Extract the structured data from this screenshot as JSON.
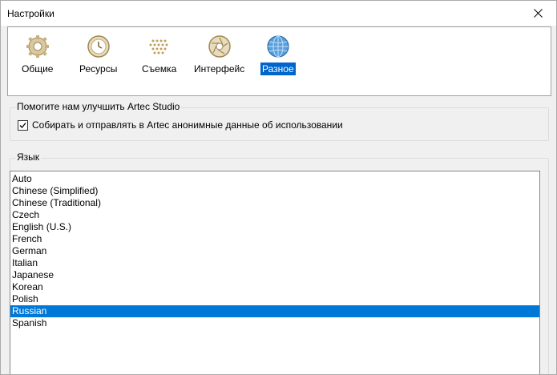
{
  "window": {
    "title": "Настройки"
  },
  "toolbar": {
    "items": [
      {
        "label": "Общие",
        "icon": "gear-icon"
      },
      {
        "label": "Ресурсы",
        "icon": "clock-icon"
      },
      {
        "label": "Съемка",
        "icon": "dots-grid-icon"
      },
      {
        "label": "Интерфейс",
        "icon": "aperture-icon"
      },
      {
        "label": "Разное",
        "icon": "globe-icon"
      }
    ],
    "active_index": 4
  },
  "improve_group": {
    "title": "Помогите нам улучшить Artec Studio",
    "checkbox_label": "Собирать и отправлять в Artec анонимные данные об использовании",
    "checked": true
  },
  "language_group": {
    "title": "Язык",
    "items": [
      "Auto",
      "Chinese (Simplified)",
      "Chinese (Traditional)",
      "Czech",
      "English (U.S.)",
      "French",
      "German",
      "Italian",
      "Japanese",
      "Korean",
      "Polish",
      "Russian",
      "Spanish"
    ],
    "selected": "Russian"
  },
  "colors": {
    "selection": "#0078d7",
    "active_tab": "#0066cc"
  }
}
